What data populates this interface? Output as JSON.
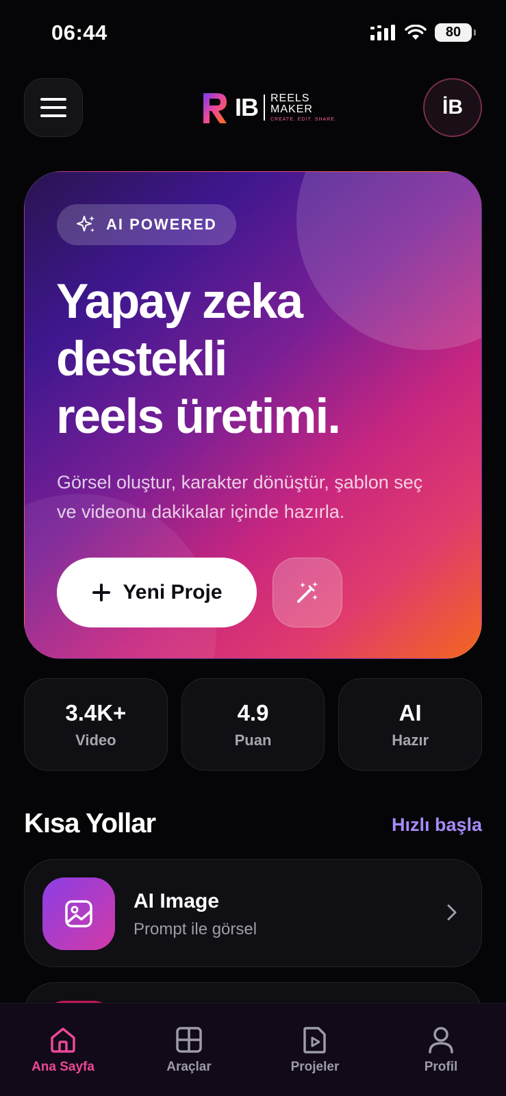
{
  "status_bar": {
    "time": "06:44",
    "battery": "80"
  },
  "header": {
    "menu_icon": "hamburger-menu-icon",
    "logo": {
      "mark": "IB",
      "line1": "REELS",
      "line2": "MAKER",
      "tagline": "CREATE. EDIT. SHARE."
    },
    "avatar_initials": "İB"
  },
  "hero": {
    "badge": "AI POWERED",
    "badge_icon": "sparkle-icon",
    "title_line1": "Yapay zeka",
    "title_line2": "destekli",
    "title_line3": "reels üretimi.",
    "subtitle": "Görsel oluştur, karakter dönüştür, şablon seç ve videonu dakikalar içinde hazırla.",
    "primary_button": "Yeni Proje",
    "secondary_button_icon": "magic-wand-icon",
    "colors": {
      "start": "#3e178f",
      "mid": "#c8267f",
      "end": "#f2661f"
    }
  },
  "stats": [
    {
      "value": "3.4K+",
      "label": "Video"
    },
    {
      "value": "4.9",
      "label": "Puan"
    },
    {
      "value": "AI",
      "label": "Hazır"
    }
  ],
  "shortcuts": {
    "title": "Kısa Yollar",
    "link": "Hızlı başla",
    "items": [
      {
        "title": "AI Image",
        "subtitle": "Prompt ile görsel",
        "icon": "image-icon"
      }
    ]
  },
  "nav": {
    "items": [
      {
        "label": "Ana Sayfa",
        "icon": "home-icon",
        "active": true
      },
      {
        "label": "Araçlar",
        "icon": "grid-icon",
        "active": false
      },
      {
        "label": "Projeler",
        "icon": "video-file-icon",
        "active": false
      },
      {
        "label": "Profil",
        "icon": "user-icon",
        "active": false
      }
    ],
    "active_color": "#ec4899"
  }
}
